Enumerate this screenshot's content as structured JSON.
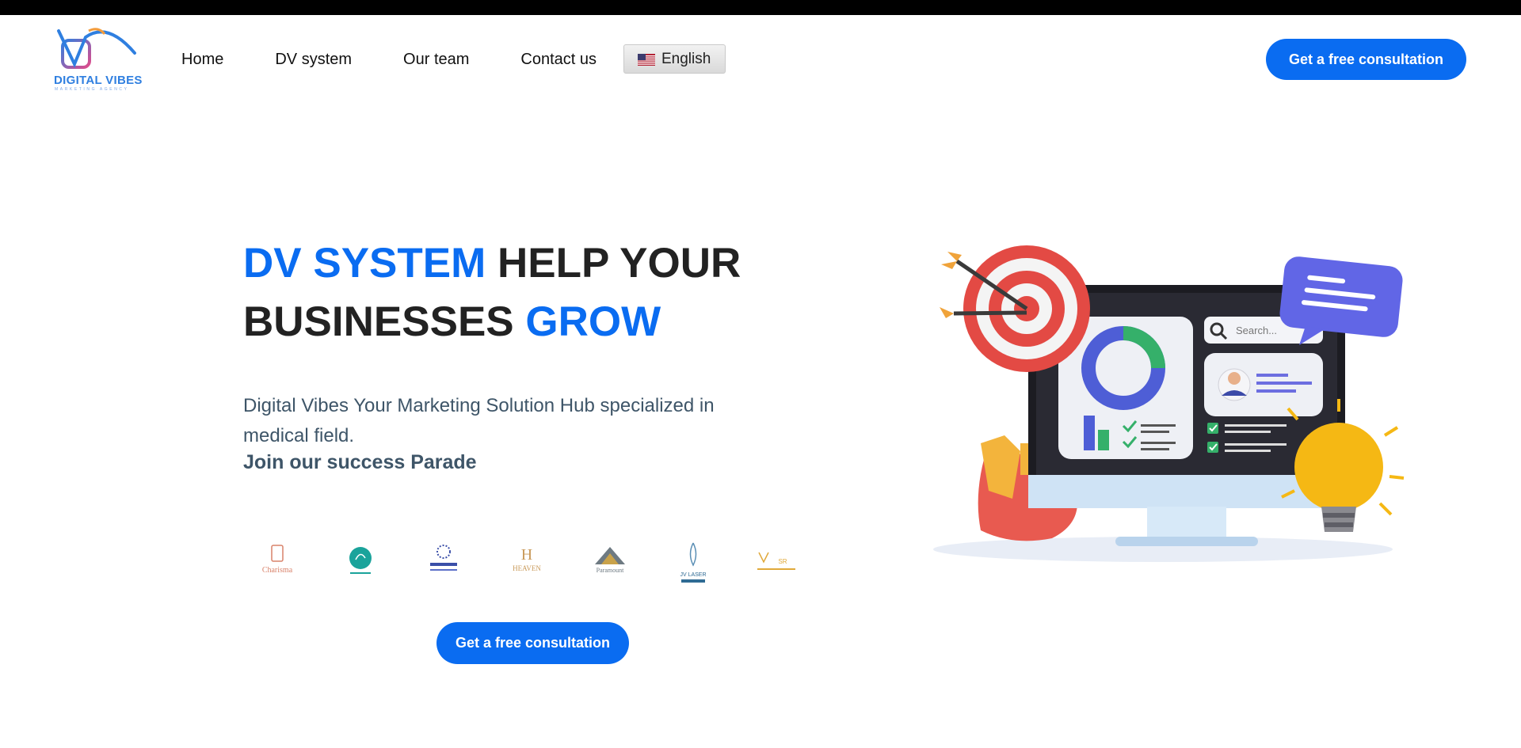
{
  "brand": {
    "logo_name": "DIGITAL VIBES",
    "logo_tagline": "MARKETING AGENCY",
    "primary_color": "#0a6cf1"
  },
  "nav": {
    "items": [
      {
        "label": "Home"
      },
      {
        "label": "DV system"
      },
      {
        "label": "Our team"
      },
      {
        "label": "Contact us"
      }
    ],
    "language": "English",
    "cta": "Get a free consultation"
  },
  "hero": {
    "title_part1": "DV SYSTEM",
    "title_part2": " HELP YOUR",
    "title_part3": "BUSINESSES ",
    "title_part4": "GROW",
    "description": "Digital Vibes Your Marketing Solution Hub specialized in medical field.",
    "tagline": "Join our success Parade",
    "cta": "Get a free consultation"
  },
  "clients": [
    {
      "name": "Charisma",
      "icon": "charisma-logo"
    },
    {
      "name": "clinic logo",
      "icon": "teal-circle-logo"
    },
    {
      "name": "medical center",
      "icon": "blue-dots-logo"
    },
    {
      "name": "HEAVEN",
      "icon": "heaven-logo"
    },
    {
      "name": "Paramount",
      "icon": "paramount-logo"
    },
    {
      "name": "JV LASER",
      "icon": "jv-laser-logo"
    },
    {
      "name": "medical centre",
      "icon": "gold-logo"
    }
  ],
  "illustration": {
    "search_placeholder": "Search..."
  }
}
